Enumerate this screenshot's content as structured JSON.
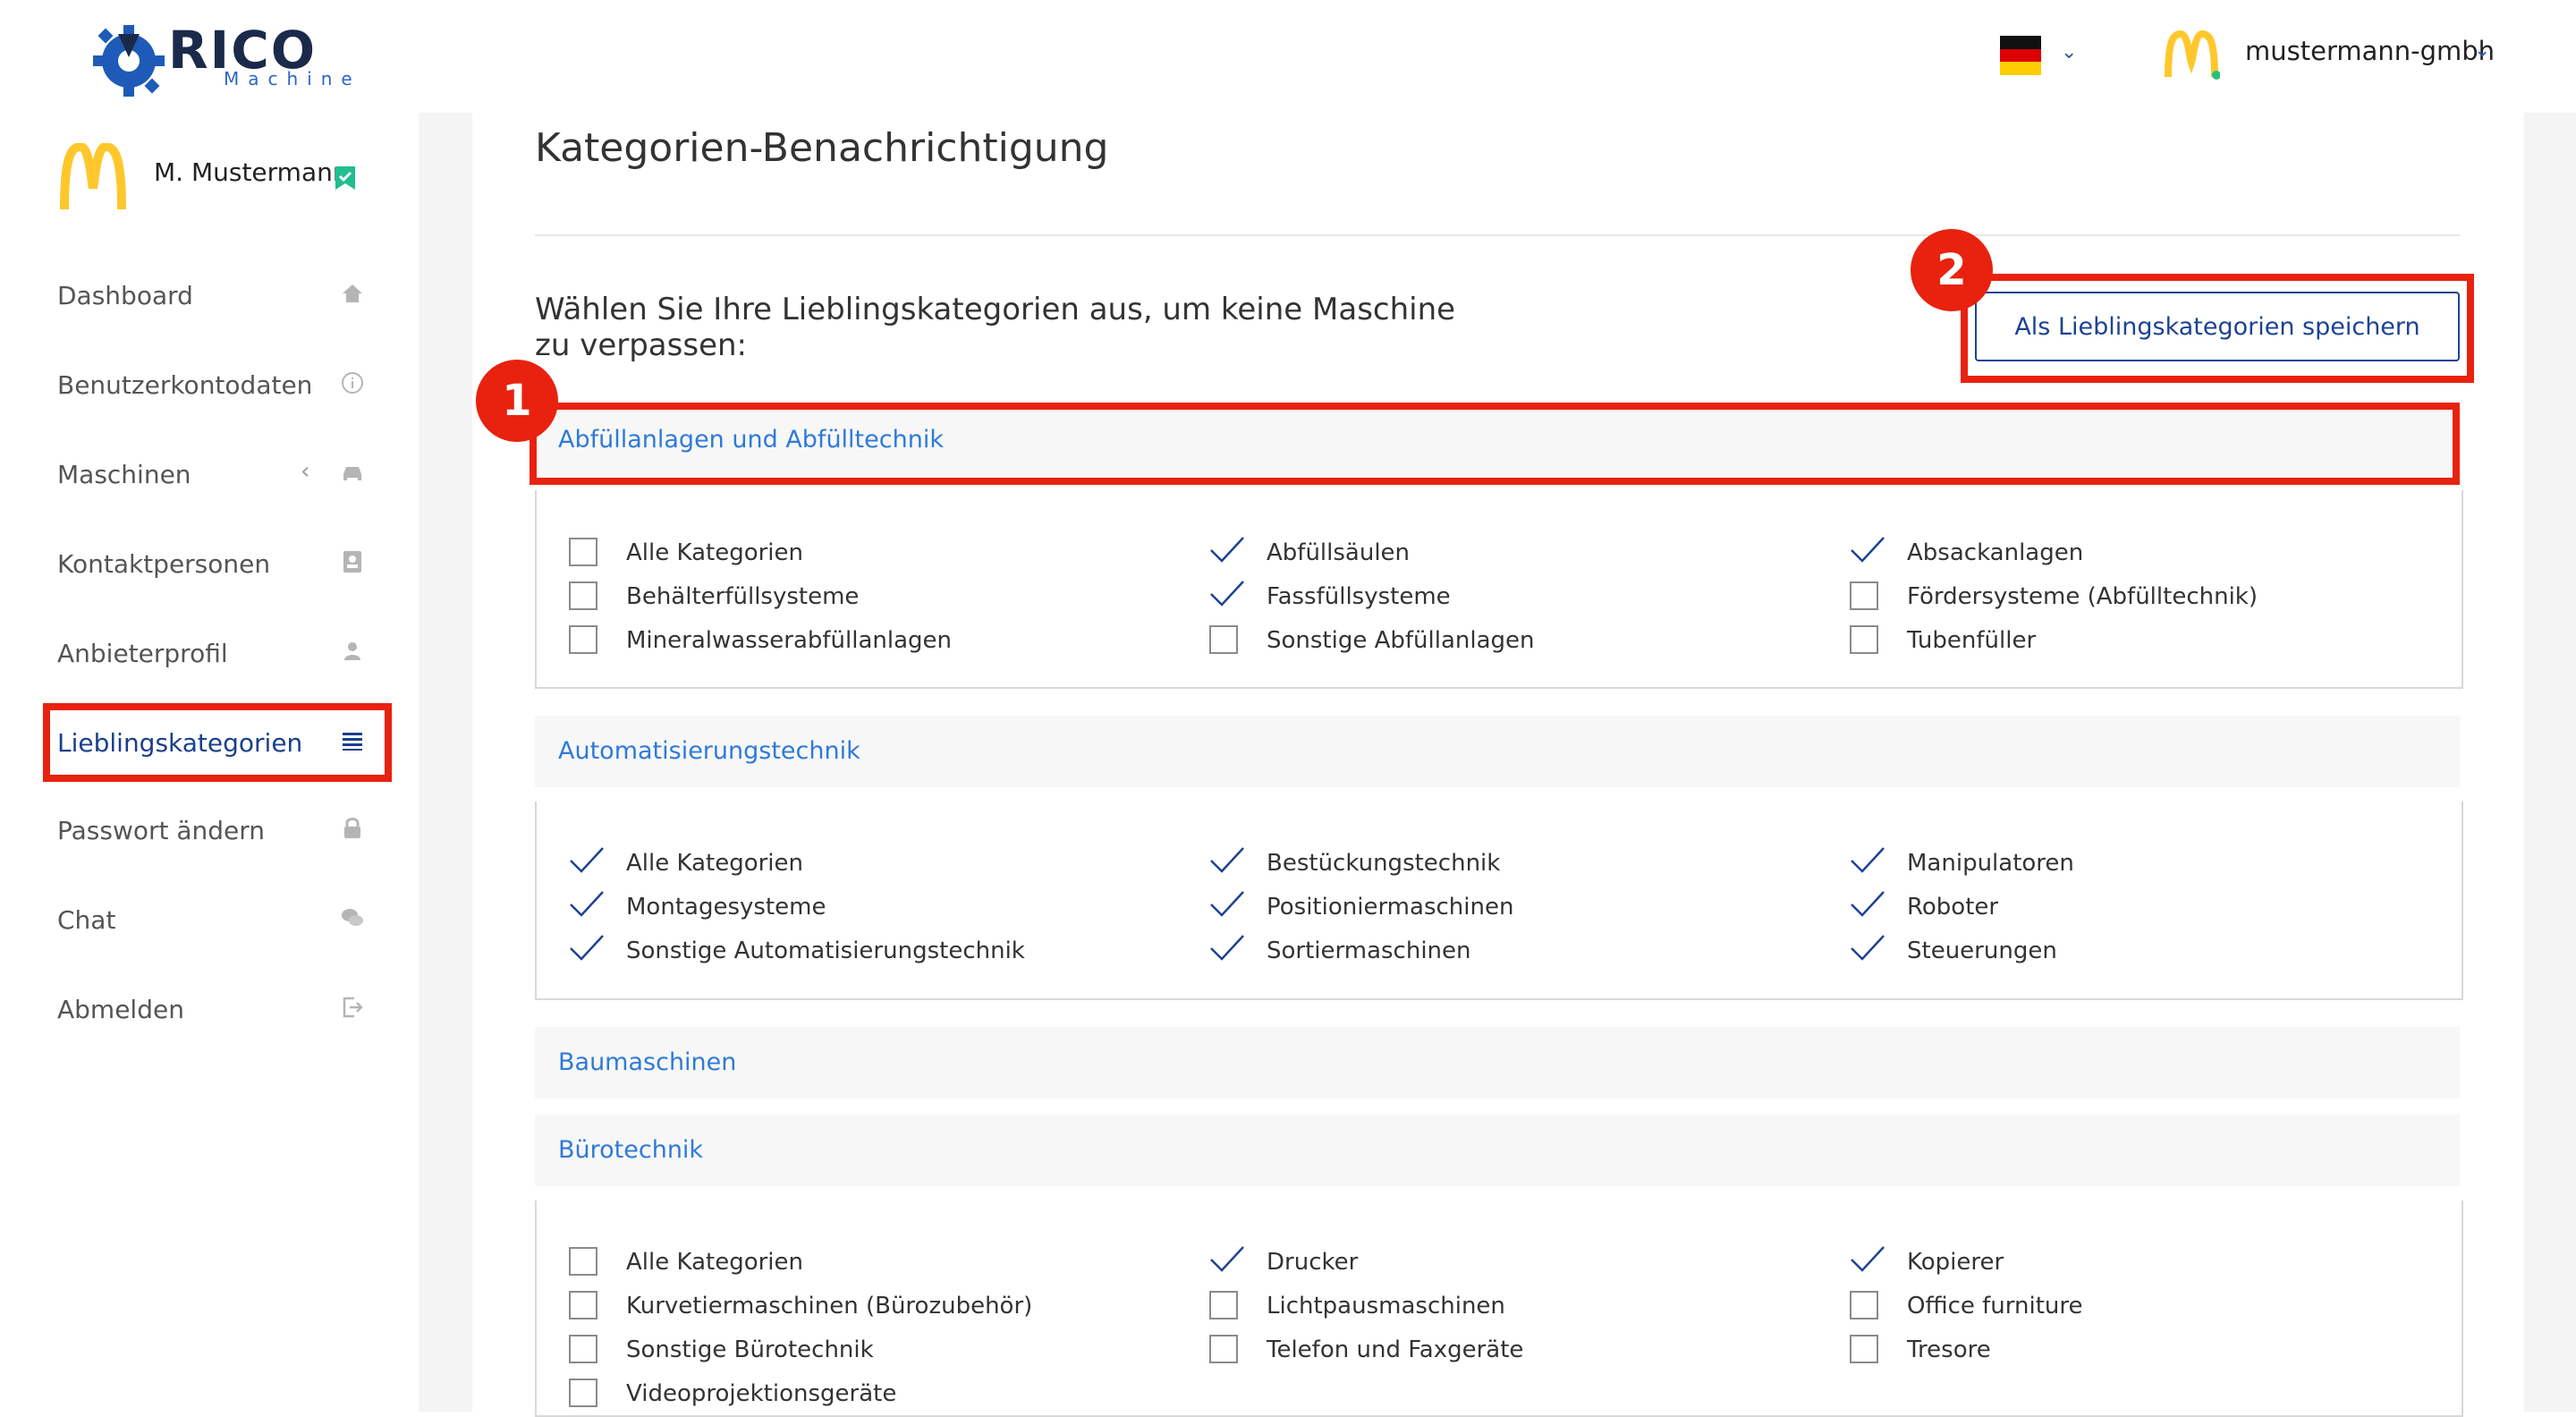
{
  "header": {
    "logo_text": "RICO",
    "logo_sub": "Machine",
    "account_name": "mustermann-gmbh"
  },
  "sidebar": {
    "user_name": "M. Mustermann",
    "items": [
      {
        "label": "Dashboard",
        "icon": "home-icon"
      },
      {
        "label": "Benutzerkontodaten",
        "icon": "info-icon"
      },
      {
        "label": "Maschinen",
        "icon": "car-icon"
      },
      {
        "label": "Kontaktpersonen",
        "icon": "contact-card-icon"
      },
      {
        "label": "Anbieterprofil",
        "icon": "user-icon"
      },
      {
        "label": "Lieblingskategorien",
        "icon": "list-icon",
        "active": true
      },
      {
        "label": "Passwort ändern",
        "icon": "lock-icon"
      },
      {
        "label": "Chat",
        "icon": "chat-icon"
      },
      {
        "label": "Abmelden",
        "icon": "logout-icon"
      }
    ]
  },
  "main": {
    "title": "Kategorien-Benachrichtigung",
    "intro": "Wählen Sie Ihre Lieblingskategorien aus, um keine Maschine zu verpassen:",
    "save_button": "Als Lieblingskategorien speichern",
    "badges": [
      "1",
      "2"
    ],
    "categories": [
      {
        "name": "Abfüllanlagen und Abfülltechnik",
        "options": [
          {
            "label": "Alle Kategorien",
            "checked": false
          },
          {
            "label": "Abfüllsäulen",
            "checked": true
          },
          {
            "label": "Absackanlagen",
            "checked": true
          },
          {
            "label": "Behälterfüllsysteme",
            "checked": false
          },
          {
            "label": "Fassfüllsysteme",
            "checked": true
          },
          {
            "label": "Fördersysteme (Abfülltechnik)",
            "checked": false
          },
          {
            "label": "Mineralwasserabfüllanlagen",
            "checked": false
          },
          {
            "label": "Sonstige Abfüllanlagen",
            "checked": false
          },
          {
            "label": "Tubenfüller",
            "checked": false
          }
        ]
      },
      {
        "name": "Automatisierungstechnik",
        "options": [
          {
            "label": "Alle Kategorien",
            "checked": true
          },
          {
            "label": "Bestückungstechnik",
            "checked": true
          },
          {
            "label": "Manipulatoren",
            "checked": true
          },
          {
            "label": "Montagesysteme",
            "checked": true
          },
          {
            "label": "Positioniermaschinen",
            "checked": true
          },
          {
            "label": "Roboter",
            "checked": true
          },
          {
            "label": "Sonstige Automatisierungstechnik",
            "checked": true
          },
          {
            "label": "Sortiermaschinen",
            "checked": true
          },
          {
            "label": "Steuerungen",
            "checked": true
          }
        ]
      },
      {
        "name": "Baumaschinen",
        "options": []
      },
      {
        "name": "Bürotechnik",
        "options": [
          {
            "label": "Alle Kategorien",
            "checked": false
          },
          {
            "label": "Drucker",
            "checked": true
          },
          {
            "label": "Kopierer",
            "checked": true
          },
          {
            "label": "Kurvetiermaschinen (Bürozubehör)",
            "checked": false
          },
          {
            "label": "Lichtpausmaschinen",
            "checked": false
          },
          {
            "label": "Office furniture",
            "checked": false
          },
          {
            "label": "Sonstige Bürotechnik",
            "checked": false
          },
          {
            "label": "Telefon und Faxgeräte",
            "checked": false
          },
          {
            "label": "Tresore",
            "checked": false
          },
          {
            "label": "Videoprojektionsgeräte",
            "checked": false
          }
        ]
      }
    ]
  },
  "colors": {
    "accent": "#1d4293",
    "link": "#2f7ad8",
    "highlight": "#e8220f",
    "mcd_yellow": "#ffc72c"
  }
}
